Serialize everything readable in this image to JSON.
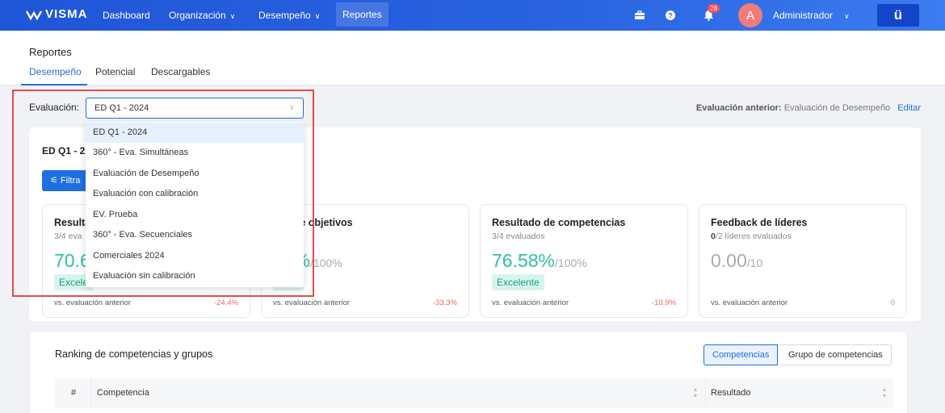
{
  "nav": {
    "brand": "VISMA",
    "items": [
      {
        "label": "Dashboard",
        "chevron": false
      },
      {
        "label": "Organización",
        "chevron": true
      },
      {
        "label": "Desempeño",
        "chevron": true
      },
      {
        "label": "Reportes",
        "chevron": false
      }
    ],
    "notifications_count": "28",
    "avatar_initial": "A",
    "user_name": "Administrador",
    "app_logo": "ü"
  },
  "page": {
    "title": "Reportes",
    "tabs": [
      "Desempeño",
      "Potencial",
      "Descargables"
    ]
  },
  "evaluation": {
    "label": "Evaluación:",
    "selected": "ED Q1 - 2024",
    "previous_label": "Evaluación anterior:",
    "previous_value": "Evaluación de Desempeño",
    "edit_label": "Editar",
    "options": [
      "ED Q1 - 2024",
      "360° - Eva. Simultáneas",
      "Evaluación de Desempeño",
      "Evaluación con calibración",
      "EV. Prueba",
      "360° - Eva. Secuenciales",
      "Comerciales 2024",
      "Evaluación sin calibración"
    ]
  },
  "card": {
    "heading": "ED Q1 - 2",
    "filter_label": "Filtra"
  },
  "metrics": [
    {
      "title": "Resultad",
      "sub": "3/4 eva",
      "value": "70.6",
      "den": "",
      "badge": "Excele",
      "vs": "vs. evaluación anterior",
      "delta": "-24.4%"
    },
    {
      "title": "ado de objetivos",
      "sub": "luados",
      "value": "57%",
      "den": "/100%",
      "badge": "lente",
      "vs": "vs. evaluación anterior",
      "delta": "-33.3%"
    },
    {
      "title": "Resultado de competencias",
      "sub": "3/4 evaluados",
      "value": "76.58%",
      "den": "/100%",
      "badge": "Excelente",
      "vs": "vs. evaluación anterior",
      "delta": "-10.9%"
    },
    {
      "title": "Feedback de líderes",
      "sub_bold": "0",
      "sub": "/2 líderes evaluados",
      "value": "0.00",
      "den": "/10",
      "badge": "",
      "vs": "vs. evaluación anterior",
      "delta": "0"
    }
  ],
  "ranking": {
    "title": "Ranking de competencias y grupos",
    "segments": [
      "Competencias",
      "Grupo de competencias"
    ],
    "columns": [
      "#",
      "Competencia",
      "Resultado"
    ]
  },
  "colors": {
    "nav_start": "#1f56d8",
    "accent": "#1e6fe0",
    "success": "#2fbfa4",
    "negative": "#f06060",
    "highlight": "#e84a4a"
  }
}
